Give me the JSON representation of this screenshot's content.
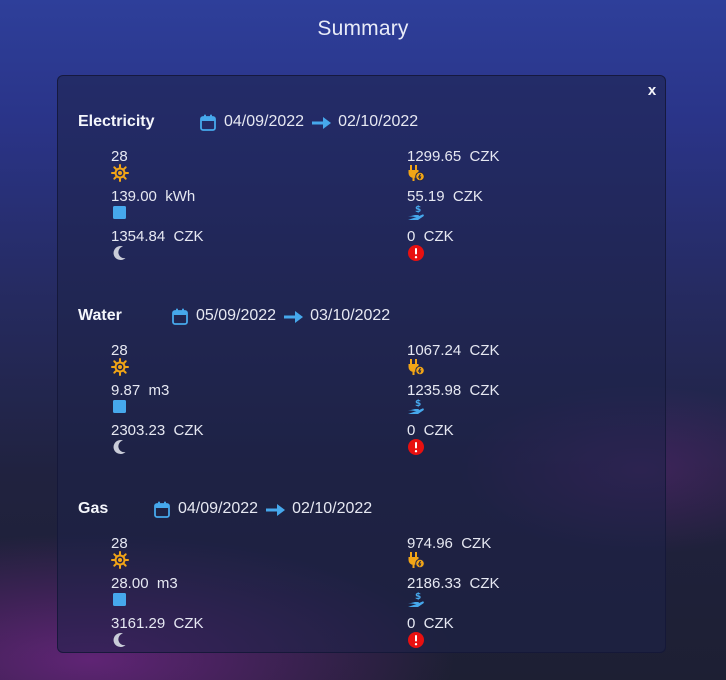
{
  "window": {
    "title": "Summary",
    "close_label": "x"
  },
  "sections": [
    {
      "name": "Electricity",
      "date_from": "04/09/2022",
      "date_to": "02/10/2022",
      "days": "28",
      "consumption": "139.00  kWh",
      "night_cost": "1354.84  CZK",
      "total_cost": "1299.65  CZK",
      "paid": "55.19  CZK",
      "difference": "0  CZK"
    },
    {
      "name": "Water",
      "date_from": "05/09/2022",
      "date_to": "03/10/2022",
      "days": "28",
      "consumption": "9.87  m3",
      "night_cost": "2303.23  CZK",
      "total_cost": "1067.24  CZK",
      "paid": "1235.98  CZK",
      "difference": "0  CZK"
    },
    {
      "name": "Gas",
      "date_from": "04/09/2022",
      "date_to": "02/10/2022",
      "days": "28",
      "consumption": "28.00  m3",
      "night_cost": "3161.29  CZK",
      "total_cost": "974.96  CZK",
      "paid": "2186.33  CZK",
      "difference": "0  CZK"
    }
  ],
  "icons": {
    "days": "sun-icon",
    "consumption": "square-icon",
    "night_cost": "moon-icon",
    "total_cost": "plug-icon",
    "paid": "hand-money-icon",
    "difference": "alert-icon"
  },
  "colors": {
    "accent_blue": "#46a8ec",
    "sun_orange": "#f2a516",
    "alert_red": "#e81010"
  }
}
